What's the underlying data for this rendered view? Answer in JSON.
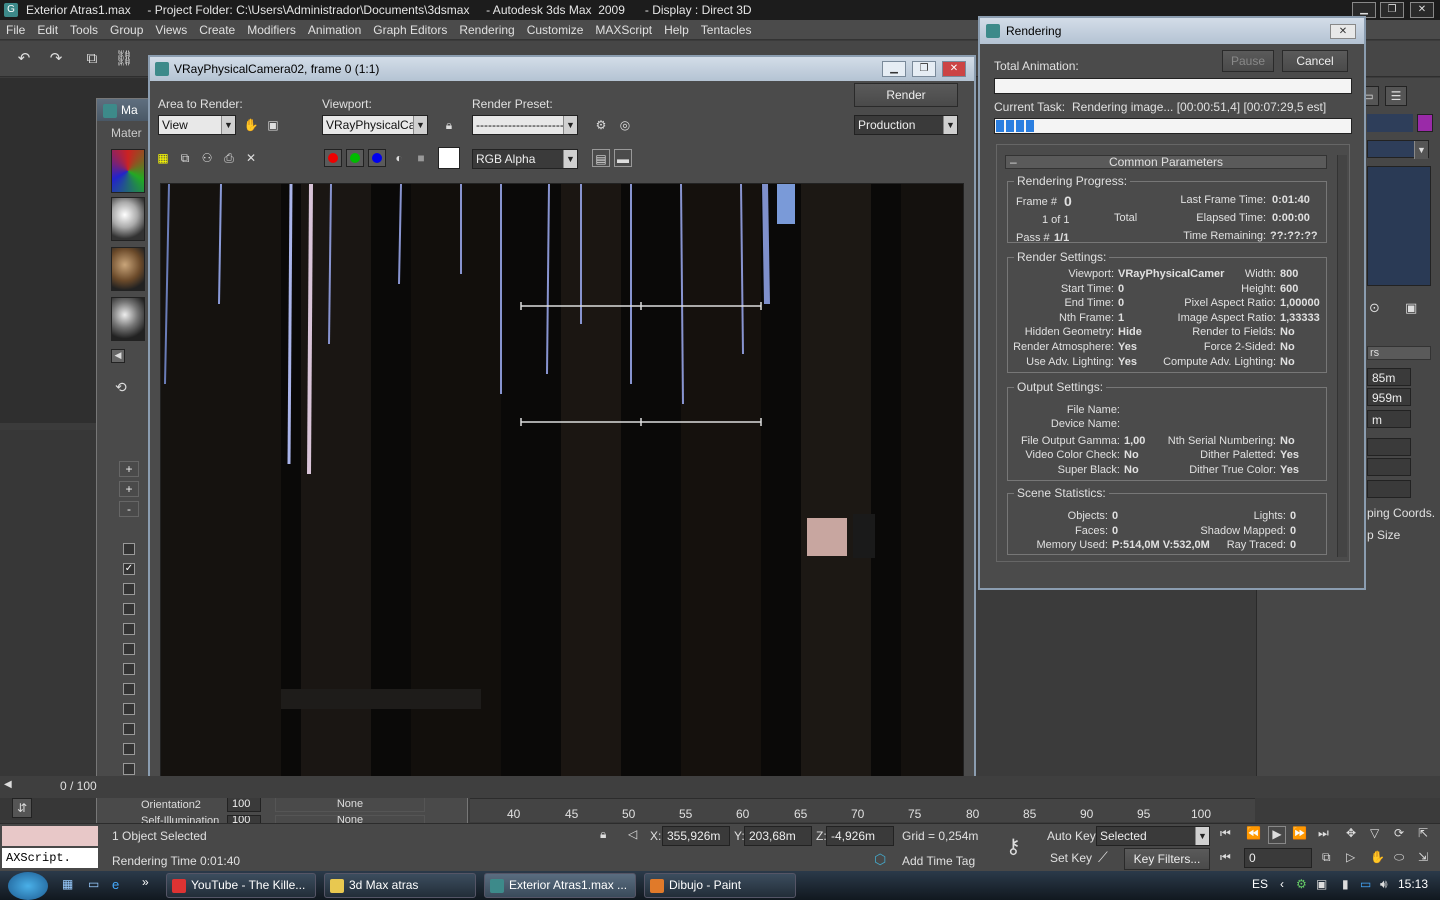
{
  "app": {
    "title": "Exterior Atras1.max     - Project Folder: C:\\Users\\Administrador\\Documents\\3dsmax     - Autodesk 3ds Max  2009      - Display : Direct 3D"
  },
  "menu": [
    "File",
    "Edit",
    "Tools",
    "Group",
    "Views",
    "Create",
    "Modifiers",
    "Animation",
    "Graph Editors",
    "Rendering",
    "Customize",
    "MAXScript",
    "Help",
    "Tentacles"
  ],
  "material_editor": {
    "title": "Ma",
    "menu_label": "Mater"
  },
  "vfb": {
    "title": "VRayPhysicalCamera02, frame 0 (1:1)",
    "area_label": "Area to Render:",
    "area_value": "View",
    "viewport_label": "Viewport:",
    "viewport_value": "VRayPhysicalCan",
    "preset_label": "Render Preset:",
    "preset_value": "----------------------",
    "render_button": "Render",
    "production_value": "Production",
    "channel_value": "RGB Alpha"
  },
  "rendering": {
    "title": "Rendering",
    "total_animation_label": "Total Animation:",
    "pause_button": "Pause",
    "cancel_button": "Cancel",
    "current_task_label": "Current Task:",
    "current_task_value": "Rendering image... [00:00:51,4] [00:07:29,5 est]",
    "task_progress": 0.11,
    "common_parameters": "Common Parameters",
    "progress_title": "Rendering Progress:",
    "frame_label": "Frame #",
    "frame_value": "0",
    "of_value": "1 of 1",
    "total_label": "Total",
    "pass_label": "Pass #",
    "pass_value": "1/1",
    "last_frame_label": "Last Frame Time:",
    "last_frame_value": "0:01:40",
    "elapsed_label": "Elapsed Time:",
    "elapsed_value": "0:00:00",
    "remaining_label": "Time Remaining:",
    "remaining_value": "??:??:??",
    "settings_title": "Render Settings:",
    "settings_left": [
      [
        "Viewport:",
        "VRayPhysicalCamer"
      ],
      [
        "Start Time:",
        "0"
      ],
      [
        "End Time:",
        "0"
      ],
      [
        "Nth Frame:",
        "1"
      ],
      [
        "Hidden Geometry:",
        "Hide"
      ],
      [
        "Render Atmosphere:",
        "Yes"
      ],
      [
        "Use Adv. Lighting:",
        "Yes"
      ]
    ],
    "settings_right": [
      [
        "Width:",
        "800"
      ],
      [
        "Height:",
        "600"
      ],
      [
        "Pixel Aspect Ratio:",
        "1,00000"
      ],
      [
        "Image Aspect Ratio:",
        "1,33333"
      ],
      [
        "Render to Fields:",
        "No"
      ],
      [
        "Force 2-Sided:",
        "No"
      ],
      [
        "Compute Adv. Lighting:",
        "No"
      ]
    ],
    "output_title": "Output Settings:",
    "file_name_label": "File Name:",
    "device_name_label": "Device Name:",
    "output_left": [
      [
        "File Output Gamma:",
        "1,00"
      ],
      [
        "Video Color Check:",
        "No"
      ],
      [
        "Super Black:",
        "No"
      ]
    ],
    "output_right": [
      [
        "Nth Serial Numbering:",
        "No"
      ],
      [
        "Dither Paletted:",
        "Yes"
      ],
      [
        "Dither True Color:",
        "Yes"
      ]
    ],
    "scene_title": "Scene Statistics:",
    "scene_left": [
      [
        "Objects:",
        "0"
      ],
      [
        "Faces:",
        "0"
      ],
      [
        "Memory Used:",
        "P:514,0M V:532,0M"
      ]
    ],
    "scene_right": [
      [
        "Lights:",
        "0"
      ],
      [
        "Shadow Mapped:",
        "0"
      ],
      [
        "Ray Traced:",
        "0"
      ]
    ]
  },
  "command_panel": {
    "spinners": [
      "85m",
      "959m",
      "m"
    ],
    "mapping_coords": "ping Coords.",
    "map_size": "p Size",
    "rollout_label": "rs"
  },
  "material_list": {
    "item1": "Orientation2",
    "item1_value": "100",
    "item1_map": "None",
    "item2": "Self-Illumination",
    "item2_value": "100",
    "item2_map": "None"
  },
  "timeline": {
    "frame_counter": "0 / 100",
    "ticks": [
      "40",
      "45",
      "50",
      "55",
      "60",
      "65",
      "70",
      "75",
      "80",
      "85",
      "90",
      "95",
      "100"
    ]
  },
  "status": {
    "selection": "1 Object Selected",
    "rendering_time": "Rendering Time  0:01:40",
    "maxscript": "AXScript.",
    "x_label": "X:",
    "x_value": "355,926m",
    "y_label": "Y:",
    "y_value": "203,68m",
    "z_label": "Z:",
    "z_value": "-4,926m",
    "grid": "Grid = 0,254m",
    "add_time_tag": "Add Time Tag",
    "auto_key": "Auto Key",
    "auto_key_value": "Selected",
    "set_key": "Set Key",
    "key_filters": "Key Filters...",
    "frame_field": "0"
  },
  "taskbar": {
    "items": [
      "YouTube - The Kille...",
      "3d Max atras",
      "Exterior Atras1.max ...",
      "Dibujo - Paint"
    ],
    "language": "ES",
    "clock": "15:13"
  }
}
